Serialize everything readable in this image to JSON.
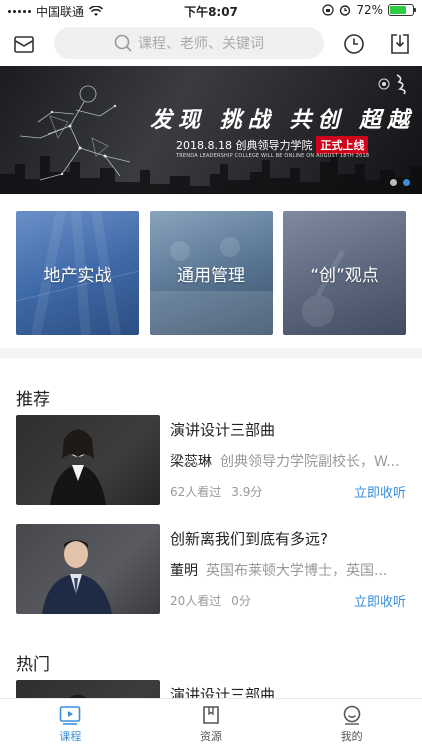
{
  "status_bar": {
    "carrier": "中国联通",
    "time": "下午8:07",
    "battery": "72%",
    "battery_level": 0.72
  },
  "header": {
    "search_placeholder": "课程、老师、关键词",
    "icons": [
      "mail-icon",
      "history-clock-icon",
      "download-icon"
    ]
  },
  "banner": {
    "headline": "发现 挑战 共创 超越",
    "subline": "2018.8.18 创典领导力学院",
    "badge": "正式上线",
    "english": "TRENDA LEADERSHIP COLLEGE WILL BE ONLINE ON AUGUST 18TH 2018",
    "slides": 2,
    "active_slide": 2
  },
  "categories": [
    {
      "label": "地产实战"
    },
    {
      "label": "通用管理"
    },
    {
      "label": "“创”观点"
    }
  ],
  "recommend": {
    "title": "推荐",
    "items": [
      {
        "title": "演讲设计三部曲",
        "teacher": "梁蕊琳",
        "desc": "创典领导力学院副校长，W...",
        "views": "62人看过",
        "score": "3.9分",
        "action": "立即收听"
      },
      {
        "title": "创新离我们到底有多远?",
        "teacher": "董明",
        "desc": "英国布莱顿大学博士，英国...",
        "views": "20人看过",
        "score": "0分",
        "action": "立即收听"
      }
    ]
  },
  "hot": {
    "title": "热门",
    "items": [
      {
        "title": "演讲设计三部曲"
      }
    ]
  },
  "tabbar": {
    "tabs": [
      {
        "label": "课程",
        "icon": "play-video-icon",
        "active": true
      },
      {
        "label": "资源",
        "icon": "book-icon",
        "active": false
      },
      {
        "label": "我的",
        "icon": "smiley-user-icon",
        "active": false
      }
    ],
    "accent": "#3a8fd8"
  }
}
